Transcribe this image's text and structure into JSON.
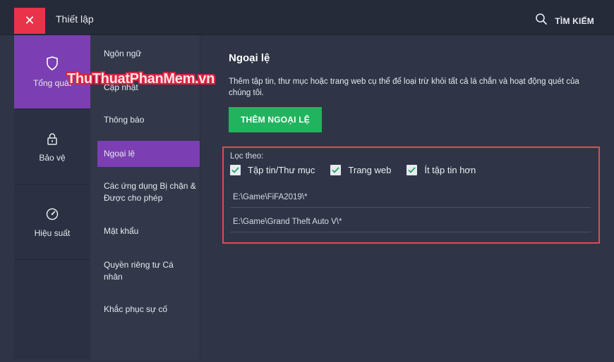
{
  "titlebar": {
    "close_label": "✕",
    "title": "Thiết lập",
    "search_label": "TÌM KIẾM"
  },
  "leftnav": {
    "items": [
      {
        "label": "Tổng quát",
        "icon": "shield-icon",
        "active": true
      },
      {
        "label": "Bảo vệ",
        "icon": "lock-icon",
        "active": false
      },
      {
        "label": "Hiệu suất",
        "icon": "gauge-icon",
        "active": false
      }
    ]
  },
  "subnav": {
    "items": [
      {
        "label": "Ngôn ngữ"
      },
      {
        "label": "Cập nhật"
      },
      {
        "label": "Thông báo"
      },
      {
        "label": "Ngoại lệ",
        "active": true
      },
      {
        "label": "Các ứng dụng Bị chặn & Được cho phép"
      },
      {
        "label": "Mật khẩu"
      },
      {
        "label": "Quyền riêng tư Cá nhân"
      },
      {
        "label": "Khắc phục sự cố"
      }
    ]
  },
  "main": {
    "title": "Ngoại lệ",
    "description": "Thêm tập tin, thư mục hoặc trang web cụ thể để loại trừ khỏi tất cả lá chắn và hoạt động quét của chúng tôi.",
    "add_button": "THÊM NGOẠI LỆ",
    "filter_label": "Lọc theo:",
    "filters": [
      {
        "label": "Tập tin/Thư mục",
        "checked": true
      },
      {
        "label": "Trang web",
        "checked": true
      },
      {
        "label": "Ít tập tin hơn",
        "checked": true
      }
    ],
    "paths": [
      "E:\\Game\\FiFA2019\\*",
      "E:\\Game\\Grand Theft Auto V\\*"
    ]
  },
  "watermark": "ThuThuatPhanMem.vn",
  "colors": {
    "accent": "#7b3fb3",
    "close": "#e8334a",
    "button": "#22b35e",
    "highlight_border": "#e04a4f"
  }
}
